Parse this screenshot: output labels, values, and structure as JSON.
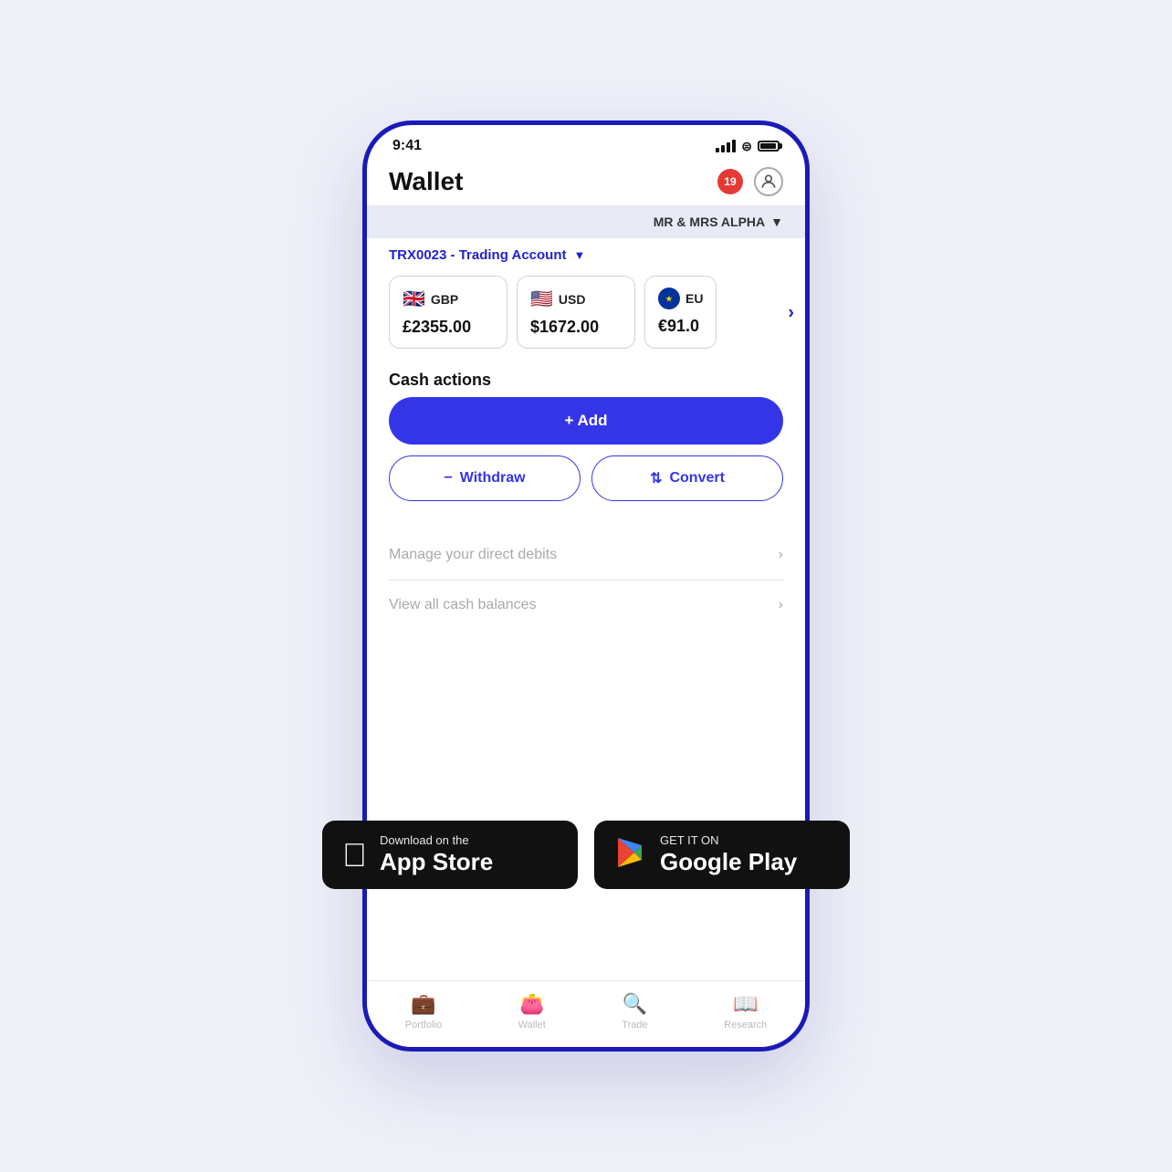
{
  "page": {
    "background_color": "#eef0f8"
  },
  "status_bar": {
    "time": "9:41"
  },
  "header": {
    "title": "Wallet",
    "notification_count": "19"
  },
  "account_selector": {
    "label": "MR & MRS ALPHA"
  },
  "trading_account": {
    "id": "TRX0023",
    "label": "TRX0023 - Trading Account"
  },
  "currencies": [
    {
      "flag": "🇬🇧",
      "code": "GBP",
      "value": "£2355.00"
    },
    {
      "flag": "🇺🇸",
      "code": "USD",
      "value": "$1672.00"
    },
    {
      "flag": "EU",
      "code": "EUR",
      "value": "€91.0"
    }
  ],
  "cash_actions": {
    "title": "Cash actions",
    "add_label": "+ Add",
    "withdraw_label": "− Withdraw",
    "convert_label": "⇄ Convert"
  },
  "app_store": {
    "ios": {
      "sub": "Download on the",
      "main": "App Store"
    },
    "android": {
      "sub": "GET IT ON",
      "main": "Google Play"
    }
  },
  "list_items": [
    {
      "label": "Manage your direct debits"
    },
    {
      "label": "View all cash balances"
    }
  ],
  "bottom_nav": [
    {
      "icon": "💼",
      "label": "Portfolio"
    },
    {
      "icon": "👛",
      "label": "Wallet"
    },
    {
      "icon": "🔍",
      "label": "Trade"
    },
    {
      "icon": "📖",
      "label": "Research"
    }
  ]
}
